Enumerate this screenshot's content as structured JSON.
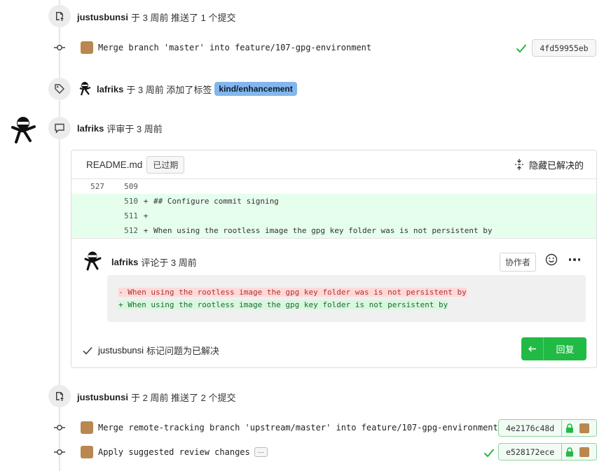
{
  "colors": {
    "green": "#21ba45",
    "label_blue": "#84b6eb",
    "timeline": "#e6e6e6"
  },
  "events": {
    "push1": {
      "user": "justusbunsi",
      "text": "于 3 周前 推送了 1 个提交"
    },
    "commit1": {
      "message": "Merge branch 'master' into feature/107-gpg-environment",
      "sha": "4fd59955eb"
    },
    "label": {
      "user": "lafriks",
      "text": "于 3 周前 添加了标签",
      "badge": "kind/enhancement"
    },
    "review": {
      "user": "lafriks",
      "text": "评审于 3 周前"
    },
    "push2": {
      "user": "justusbunsi",
      "text": "于 2 周前 推送了 2 个提交"
    },
    "commit2": {
      "message": "Merge remote-tracking branch 'upstream/master' into feature/107-gpg-environment",
      "sha": "4e2176c48d"
    },
    "commit3": {
      "message": "Apply suggested review changes",
      "sha": "e528172ece",
      "more": "···"
    }
  },
  "review_box": {
    "file": "README.md",
    "outdated": "已过期",
    "hide_resolved": "隐藏已解决的",
    "diff": [
      {
        "old": "527",
        "new": "509",
        "sign": "",
        "code": "",
        "type": "ctx"
      },
      {
        "old": "",
        "new": "510",
        "sign": "+",
        "code": "## Configure commit signing",
        "type": "add"
      },
      {
        "old": "",
        "new": "511",
        "sign": "+",
        "code": "",
        "type": "add"
      },
      {
        "old": "",
        "new": "512",
        "sign": "+",
        "code": "When using the rootless image the gpg key folder was is not persistent by",
        "type": "add"
      }
    ],
    "comment": {
      "user": "lafriks",
      "text": "评论于 3 周前",
      "role": "协作者",
      "suggestion_del": "- When using the rootless image the gpg key folder was is not persistent by",
      "suggestion_add": "+ When using the rootless image the gpg key folder is not persistent by"
    },
    "resolved": {
      "user": "justusbunsi",
      "text": "标记问题为已解决"
    },
    "reply_label": "回复"
  }
}
